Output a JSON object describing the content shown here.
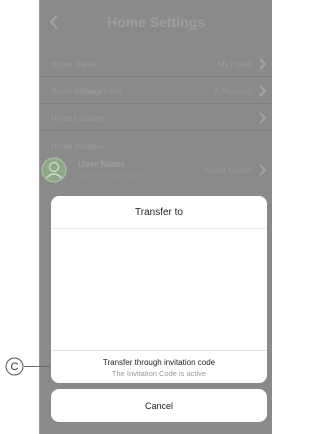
{
  "header": {
    "title": "Home Settings"
  },
  "rows": [
    {
      "label": "Home Name",
      "value": "My Home"
    },
    {
      "label": "Room Management",
      "value": "5 Room(s)"
    },
    {
      "label": "Home Location",
      "value": ""
    }
  ],
  "members": {
    "section_label": "Home Member",
    "items": [
      {
        "name": "User Name",
        "sub": "user@example.com",
        "role": "Home Owner"
      }
    ]
  },
  "sheet": {
    "title": "Transfer to",
    "option_main": "Transfer through invitation code",
    "option_sub": "The Invitation Code is active",
    "cancel_label": "Cancel"
  },
  "callout": {
    "label": "C"
  },
  "colors": {
    "overlay": "#8a8a8a",
    "sheet_bg": "#ffffff",
    "accent_avatar": "#6fb05a"
  },
  "icons": [
    "back-icon",
    "chevron-right-icon",
    "avatar-icon"
  ]
}
